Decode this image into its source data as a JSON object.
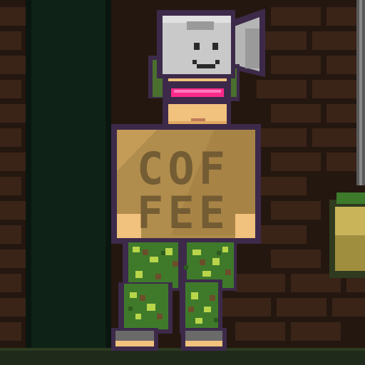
{
  "scene": {
    "shirt_text_line1": "COF",
    "shirt_text_line2": "FEE"
  },
  "colors": {
    "background_dark": "#1c1a16",
    "brick": "#3a2418",
    "brick_mortar": "#24170f",
    "left_pillar": "#0f2218",
    "outline": "#3d2a4a",
    "skin": "#f1c27d",
    "shirt": "#b08d4d",
    "visor": "#ff2a8a",
    "mask": "#c9c9c9",
    "axe_blade": "#b5b5b5",
    "camo_base": "#3f7a2b",
    "camo_light": "#b9d54a",
    "camo_dark": "#6b4e2a",
    "hair": "#4a6f2e",
    "floor": "#1f2a1a"
  }
}
